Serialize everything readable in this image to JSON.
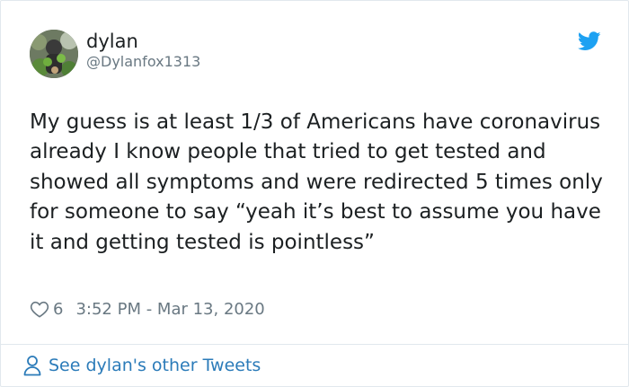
{
  "author": {
    "name": "dylan",
    "handle": "@Dylanfox1313"
  },
  "tweet": {
    "text": "My guess is at least 1/3 of Americans have coronavirus already I know people that tried to get tested and showed all symptoms and were redirected 5 times only for someone to say “yeah it’s best to assume you have it and getting tested is pointless”",
    "like_count": "6",
    "timestamp": "3:52 PM - Mar 13, 2020"
  },
  "footer": {
    "other_tweets_label": "See dylan's other Tweets"
  },
  "icons": {
    "brand": "twitter-bird-icon",
    "like": "heart-icon",
    "profile": "person-icon"
  },
  "colors": {
    "brand_blue": "#1da1f2",
    "link_blue": "#2b7bb9",
    "text": "#1c2022",
    "muted": "#697882",
    "border": "#e1e8ed"
  }
}
